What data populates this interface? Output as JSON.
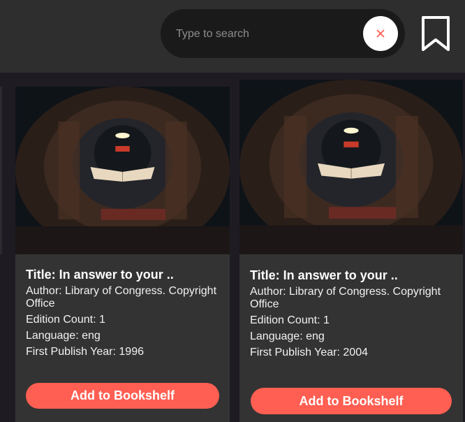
{
  "search": {
    "placeholder": "Type to search",
    "value": ""
  },
  "colors": {
    "accent": "#ff5f52",
    "topbar": "#2e2e2e",
    "card": "#333333"
  },
  "icons": {
    "clear": "close-icon",
    "bookmark": "bookmark-icon"
  },
  "cards": [
    {
      "title": "Title: In answer to your ..",
      "author": "Author: Library of Congress. Copyright Office",
      "edition": "Edition Count: 1",
      "language": "Language: eng",
      "year": "First Publish Year: 1996",
      "button": "Add to Bookshelf"
    },
    {
      "title": "Title: In answer to your ..",
      "author": "Author: Library of Congress. Copyright Office",
      "edition": "Edition Count: 1",
      "language": "Language: eng",
      "year": "First Publish Year: 2004",
      "button": "Add to Bookshelf"
    }
  ]
}
